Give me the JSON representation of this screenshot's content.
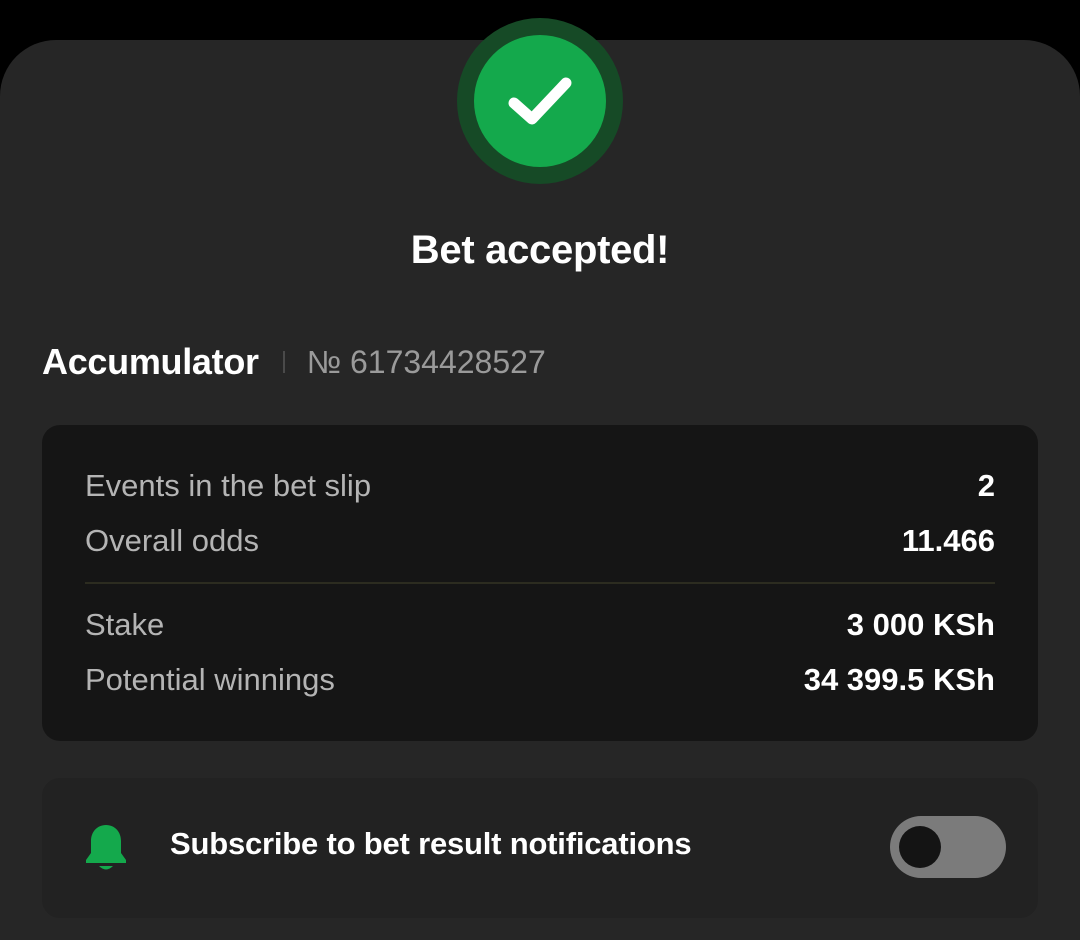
{
  "header": {
    "title": "Bet accepted!",
    "status_icon": "check-icon"
  },
  "bet": {
    "type": "Accumulator",
    "number": "№ 61734428527"
  },
  "summary": {
    "rows": [
      {
        "label": "Events in the bet slip",
        "value": "2"
      },
      {
        "label": "Overall odds",
        "value": "11.466"
      },
      {
        "label": "Stake",
        "value": "3 000 KSh"
      },
      {
        "label": "Potential winnings",
        "value": "34 399.5 KSh"
      }
    ]
  },
  "notifications": {
    "icon": "bell-icon",
    "label": "Subscribe to bet result notifications",
    "toggle_on": false
  },
  "colors": {
    "accent_green": "#14a94c",
    "background": "#262626",
    "card": "#151515"
  }
}
